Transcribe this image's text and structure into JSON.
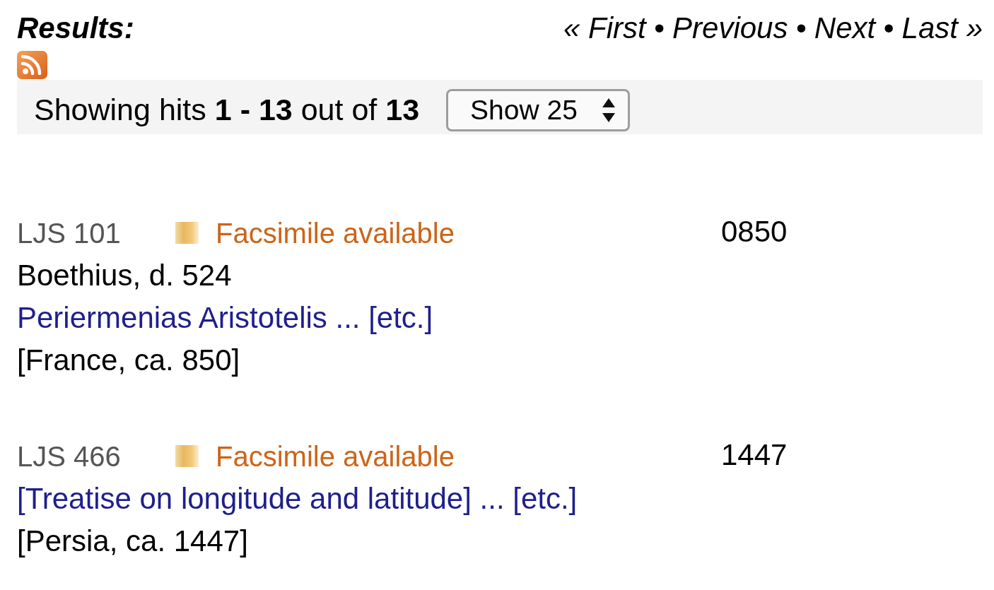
{
  "header": {
    "title": "Results:",
    "pager": {
      "links": [
        "« First",
        "Previous",
        "Next",
        "Last »"
      ],
      "separators": [
        "•",
        "•",
        "•"
      ]
    }
  },
  "toolbar": {
    "summary": "Showing hits **1 - 13** out of **13**",
    "page_size": {
      "value": "Show 25"
    }
  },
  "records": [
    {
      "shelfmark": "LJS 101",
      "facsimile": "Facsimile available",
      "date": "0850",
      "author": "Boethius, d. 524",
      "title": "Periermenias Aristotelis ... [etc.]",
      "origin": "[France, ca. 850]"
    },
    {
      "shelfmark": "LJS 466",
      "facsimile": "Facsimile available",
      "date": "1447",
      "title": "[Treatise on longitude and latitude] ... [etc.]",
      "origin": "[Persia, ca. 1447]"
    }
  ]
}
